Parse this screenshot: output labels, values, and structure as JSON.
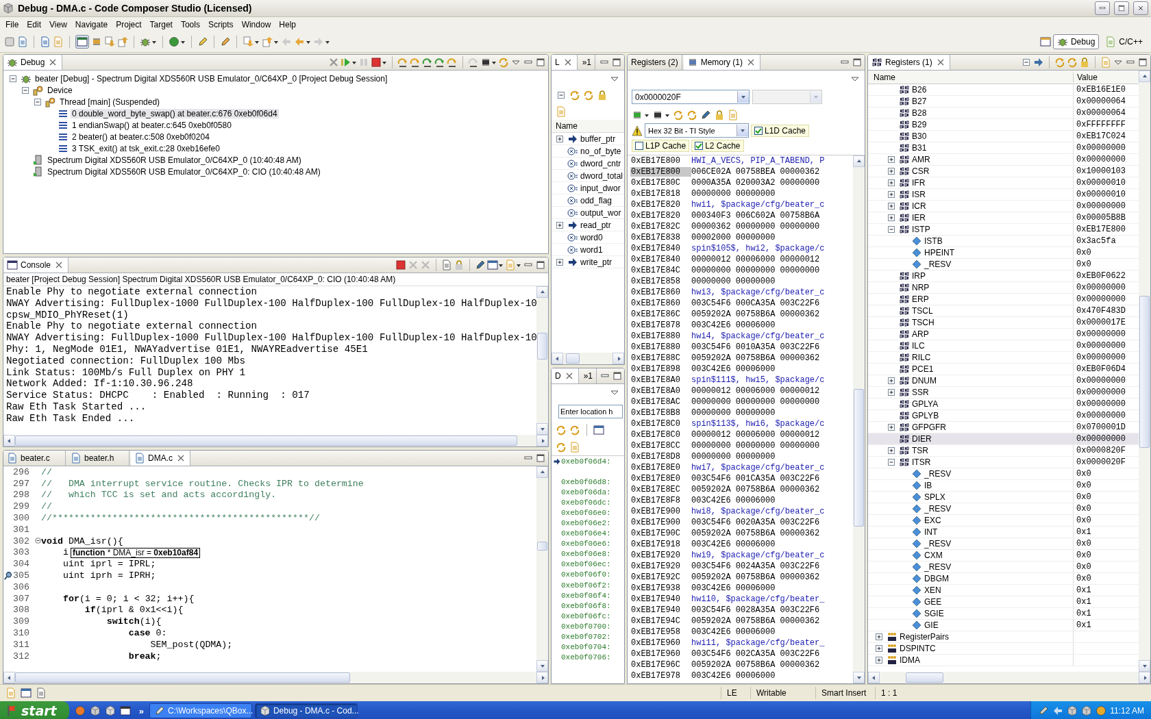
{
  "window": {
    "title": "Debug - DMA.c - Code Composer Studio (Licensed)"
  },
  "menu": [
    "File",
    "Edit",
    "View",
    "Navigate",
    "Project",
    "Target",
    "Tools",
    "Scripts",
    "Window",
    "Help"
  ],
  "perspectives": [
    {
      "label": "Debug",
      "selected": true
    },
    {
      "label": "C/C++",
      "selected": false
    }
  ],
  "debug_view": {
    "tab": "Debug",
    "tree": [
      {
        "label": "beater [Debug] - Spectrum Digital XDS560R USB Emulator_0/C64XP_0 [Project Debug Session]",
        "kind": "session",
        "expanded": true,
        "selected": false,
        "children": [
          {
            "label": "Device",
            "kind": "device",
            "expanded": true,
            "selected": false,
            "children": [
              {
                "label": "Thread [main] (Suspended)",
                "kind": "thread",
                "expanded": true,
                "selected": false,
                "children": [
                  {
                    "label": "0 double_word_byte_swap() at beater.c:676 0xeb0f06d4",
                    "kind": "frame",
                    "selected": true
                  },
                  {
                    "label": "1 endianSwap() at beater.c:645 0xeb0f0580",
                    "kind": "frame",
                    "selected": false
                  },
                  {
                    "label": "2 beater() at beater.c:508 0xeb0f0204",
                    "kind": "frame",
                    "selected": false
                  },
                  {
                    "label": "3 TSK_exit() at tsk_exit.c:28 0xeb16efe0",
                    "kind": "frame",
                    "selected": false
                  }
                ]
              }
            ]
          },
          {
            "label": "Spectrum Digital XDS560R USB Emulator_0/C64XP_0 (10:40:48 AM)",
            "kind": "process",
            "selected": false
          },
          {
            "label": "Spectrum Digital XDS560R USB Emulator_0/C64XP_0: CIO (10:40:48 AM)",
            "kind": "process",
            "selected": false
          }
        ]
      }
    ]
  },
  "console": {
    "tab": "Console",
    "header": "beater [Project Debug Session] Spectrum Digital XDS560R USB Emulator_0/C64XP_0: CIO (10:40:48 AM)",
    "lines": [
      "Enable Phy to negotiate external connection",
      "NWAY Advertising: FullDuplex-1000 FullDuplex-100 HalfDuplex-100 FullDuplex-10 HalfDuplex-10",
      "cpsw_MDIO_PhYReset(1)",
      "Enable Phy to negotiate external connection",
      "NWAY Advertising: FullDuplex-1000 FullDuplex-100 HalfDuplex-100 FullDuplex-10 HalfDuplex-10",
      "Phy: 1, NegMode 01E1, NWAYadvertise 01E1, NWAYREadvertise 45E1",
      "Negotiated connection: FullDuplex 100 Mbs",
      "Link Status: 100Mb/s Full Duplex on PHY 1",
      "Network Added: If-1:10.30.96.248",
      "Service Status: DHCPC    : Enabled  : Running  : 017",
      "Raw Eth Task Started ...",
      "Raw Eth Task Ended ..."
    ]
  },
  "editor": {
    "tabs": [
      {
        "label": "beater.c",
        "selected": false
      },
      {
        "label": "beater.h",
        "selected": false
      },
      {
        "label": "DMA.c",
        "selected": true
      }
    ],
    "hover_tooltip": "**function** * DMA_isr = **0xeb10af84**",
    "lines": [
      {
        "number": "296",
        "kind": "comment",
        "text": "//",
        "fold": false,
        "marker": false,
        "hover": false
      },
      {
        "number": "297",
        "kind": "comment",
        "text": "//   DMA interrupt service routine. Checks IPR to determine",
        "fold": false,
        "marker": false,
        "hover": false
      },
      {
        "number": "298",
        "kind": "comment",
        "text": "//   which TCC is set and acts accordingly.",
        "fold": false,
        "marker": false,
        "hover": false
      },
      {
        "number": "299",
        "kind": "comment",
        "text": "//",
        "fold": false,
        "marker": false,
        "hover": false
      },
      {
        "number": "300",
        "kind": "comment",
        "text": "//***********************************************//",
        "fold": false,
        "marker": false,
        "hover": false
      },
      {
        "number": "301",
        "kind": "code",
        "fold": false,
        "marker": false,
        "hover": false
      },
      {
        "number": "302",
        "kind": "code",
        "text": "**void** DMA_isr(){",
        "fold": true,
        "marker": false,
        "hover": false
      },
      {
        "number": "303",
        "kind": "code",
        "text": "    i",
        "fold": false,
        "marker": false,
        "hover": true
      },
      {
        "number": "304",
        "kind": "code",
        "text": "    uint iprl = IPRL;",
        "fold": false,
        "marker": false,
        "hover": false
      },
      {
        "number": "305",
        "kind": "code",
        "text": "    uint iprh = IPRH;",
        "fold": false,
        "marker": true,
        "hover": false
      },
      {
        "number": "306",
        "kind": "code",
        "fold": false,
        "marker": false,
        "hover": false
      },
      {
        "number": "307",
        "kind": "code",
        "text": "    **for**(i = 0; i < 32; i++){",
        "fold": false,
        "marker": false,
        "hover": false
      },
      {
        "number": "308",
        "kind": "code",
        "text": "        **if**(iprl & 0x1<<i){",
        "fold": false,
        "marker": false,
        "hover": false
      },
      {
        "number": "309",
        "kind": "code",
        "text": "            **switch**(i){",
        "fold": false,
        "marker": false,
        "hover": false
      },
      {
        "number": "310",
        "kind": "code",
        "text": "                **case** 0:",
        "fold": false,
        "marker": false,
        "hover": false
      },
      {
        "number": "311",
        "kind": "code",
        "text": "                    SEM_post(QDMA);",
        "fold": false,
        "marker": false,
        "hover": false
      },
      {
        "number": "312",
        "kind": "code",
        "text": "                **break**;",
        "fold": false,
        "marker": false,
        "hover": false
      }
    ]
  },
  "variables": {
    "tabs": [
      {
        "label": "L",
        "selected": true
      },
      {
        "label": "»1",
        "selected": false
      }
    ],
    "column": "Name",
    "rows": [
      {
        "name": "buffer_ptr",
        "kind": "pointer",
        "expanded": false
      },
      {
        "name": "no_of_byte",
        "kind": "variable"
      },
      {
        "name": "dword_cntr",
        "kind": "variable"
      },
      {
        "name": "dword_total",
        "kind": "variable"
      },
      {
        "name": "input_dwor",
        "kind": "variable"
      },
      {
        "name": "odd_flag",
        "kind": "variable"
      },
      {
        "name": "output_wor",
        "kind": "variable"
      },
      {
        "name": "read_ptr",
        "kind": "pointer",
        "expanded": false
      },
      {
        "name": "word0",
        "kind": "variable"
      },
      {
        "name": "word1",
        "kind": "variable"
      },
      {
        "name": "write_ptr",
        "kind": "pointer",
        "expanded": false
      }
    ]
  },
  "disassembly": {
    "tabs": [
      {
        "label": "D",
        "selected": true
      },
      {
        "label": "»1",
        "selected": false
      }
    ],
    "placeholder": "Enter location h",
    "rows": [
      {
        "address": "0xeb0f06d4:",
        "current": true
      },
      {
        "address": "0xeb0f06d8:",
        "current": false
      },
      {
        "address": "0xeb0f06da:",
        "current": false
      },
      {
        "address": "0xeb0f06dc:",
        "current": false
      },
      {
        "address": "0xeb0f06e0:",
        "current": false
      },
      {
        "address": "0xeb0f06e2:",
        "current": false
      },
      {
        "address": "0xeb0f06e4:",
        "current": false
      },
      {
        "address": "0xeb0f06e6:",
        "current": false
      },
      {
        "address": "0xeb0f06e8:",
        "current": false
      },
      {
        "address": "0xeb0f06ec:",
        "current": false
      },
      {
        "address": "0xeb0f06f0:",
        "current": false
      },
      {
        "address": "0xeb0f06f2:",
        "current": false
      },
      {
        "address": "0xeb0f06f4:",
        "current": false
      },
      {
        "address": "0xeb0f06f8:",
        "current": false
      },
      {
        "address": "0xeb0f06fc:",
        "current": false
      },
      {
        "address": "0xeb0f0700:",
        "current": false
      },
      {
        "address": "0xeb0f0702:",
        "current": false
      },
      {
        "address": "0xeb0f0704:",
        "current": false
      },
      {
        "address": "0xeb0f0706:",
        "current": false
      }
    ]
  },
  "memory": {
    "tabs": [
      {
        "label": "Registers (2)",
        "selected": false
      },
      {
        "label": "Memory (1)",
        "selected": true
      }
    ],
    "address": "0x0000020F",
    "format": "Hex 32 Bit - TI Style",
    "caches": [
      {
        "label": "L1D Cache",
        "checked": true
      },
      {
        "label": "L1P Cache",
        "checked": false
      },
      {
        "label": "L2 Cache",
        "checked": true
      }
    ],
    "rows": [
      {
        "address": "0xEB17E800",
        "kind": "label",
        "content": "HWI_A_VECS, PIP_A_TABEND, P",
        "selected": false
      },
      {
        "address": "0xEB17E800",
        "kind": "data",
        "content": "006CE02A 00758BEA 00000362",
        "selected": true
      },
      {
        "address": "0xEB17E80C",
        "kind": "data",
        "content": "0000A35A 020003A2 00000000",
        "selected": false
      },
      {
        "address": "0xEB17E818",
        "kind": "data",
        "content": "00000000 00000000",
        "selected": false
      },
      {
        "address": "0xEB17E820",
        "kind": "label",
        "content": "hwi1, $package/cfg/beater_c",
        "selected": false
      },
      {
        "address": "0xEB17E820",
        "kind": "data",
        "content": "000340F3 006C602A 00758B6A",
        "selected": false
      },
      {
        "address": "0xEB17E82C",
        "kind": "data",
        "content": "00000362 00000000 00000000",
        "selected": false
      },
      {
        "address": "0xEB17E838",
        "kind": "data",
        "content": "00002000 00000000",
        "selected": false
      },
      {
        "address": "0xEB17E840",
        "kind": "label",
        "content": "spin$105$, hwi2, $package/c",
        "selected": false
      },
      {
        "address": "0xEB17E840",
        "kind": "data",
        "content": "00000012 00006000 00000012",
        "selected": false
      },
      {
        "address": "0xEB17E84C",
        "kind": "data",
        "content": "00000000 00000000 00000000",
        "selected": false
      },
      {
        "address": "0xEB17E858",
        "kind": "data",
        "content": "00000000 00000000",
        "selected": false
      },
      {
        "address": "0xEB17E860",
        "kind": "label",
        "content": "hwi3, $package/cfg/beater_c",
        "selected": false
      },
      {
        "address": "0xEB17E860",
        "kind": "data",
        "content": "003C54F6 000CA35A 003C22F6",
        "selected": false
      },
      {
        "address": "0xEB17E86C",
        "kind": "data",
        "content": "0059202A 00758B6A 00000362",
        "selected": false
      },
      {
        "address": "0xEB17E878",
        "kind": "data",
        "content": "003C42E6 00006000",
        "selected": false
      },
      {
        "address": "0xEB17E880",
        "kind": "label",
        "content": "hwi4, $package/cfg/beater_c",
        "selected": false
      },
      {
        "address": "0xEB17E880",
        "kind": "data",
        "content": "003C54F6 0010A35A 003C22F6",
        "selected": false
      },
      {
        "address": "0xEB17E88C",
        "kind": "data",
        "content": "0059202A 00758B6A 00000362",
        "selected": false
      },
      {
        "address": "0xEB17E898",
        "kind": "data",
        "content": "003C42E6 00006000",
        "selected": false
      },
      {
        "address": "0xEB17E8A0",
        "kind": "label",
        "content": "spin$111$, hwi5, $package/c",
        "selected": false
      },
      {
        "address": "0xEB17E8A0",
        "kind": "data",
        "content": "00000012 00006000 00000012",
        "selected": false
      },
      {
        "address": "0xEB17E8AC",
        "kind": "data",
        "content": "00000000 00000000 00000000",
        "selected": false
      },
      {
        "address": "0xEB17E8B8",
        "kind": "data",
        "content": "00000000 00000000",
        "selected": false
      },
      {
        "address": "0xEB17E8C0",
        "kind": "label",
        "content": "spin$113$, hwi6, $package/c",
        "selected": false
      },
      {
        "address": "0xEB17E8C0",
        "kind": "data",
        "content": "00000012 00006000 00000012",
        "selected": false
      },
      {
        "address": "0xEB17E8CC",
        "kind": "data",
        "content": "00000000 00000000 00000000",
        "selected": false
      },
      {
        "address": "0xEB17E8D8",
        "kind": "data",
        "content": "00000000 00000000",
        "selected": false
      },
      {
        "address": "0xEB17E8E0",
        "kind": "label",
        "content": "hwi7, $package/cfg/beater_c",
        "selected": false
      },
      {
        "address": "0xEB17E8E0",
        "kind": "data",
        "content": "003C54F6 001CA35A 003C22F6",
        "selected": false
      },
      {
        "address": "0xEB17E8EC",
        "kind": "data",
        "content": "0059202A 00758B6A 00000362",
        "selected": false
      },
      {
        "address": "0xEB17E8F8",
        "kind": "data",
        "content": "003C42E6 00006000",
        "selected": false
      },
      {
        "address": "0xEB17E900",
        "kind": "label",
        "content": "hwi8, $package/cfg/beater_c",
        "selected": false
      },
      {
        "address": "0xEB17E900",
        "kind": "data",
        "content": "003C54F6 0020A35A 003C22F6",
        "selected": false
      },
      {
        "address": "0xEB17E90C",
        "kind": "data",
        "content": "0059202A 00758B6A 00000362",
        "selected": false
      },
      {
        "address": "0xEB17E918",
        "kind": "data",
        "content": "003C42E6 00006000",
        "selected": false
      },
      {
        "address": "0xEB17E920",
        "kind": "label",
        "content": "hwi9, $package/cfg/beater_c",
        "selected": false
      },
      {
        "address": "0xEB17E920",
        "kind": "data",
        "content": "003C54F6 0024A35A 003C22F6",
        "selected": false
      },
      {
        "address": "0xEB17E92C",
        "kind": "data",
        "content": "0059202A 00758B6A 00000362",
        "selected": false
      },
      {
        "address": "0xEB17E938",
        "kind": "data",
        "content": "003C42E6 00006000",
        "selected": false
      },
      {
        "address": "0xEB17E940",
        "kind": "label",
        "content": "hwi10, $package/cfg/beater_",
        "selected": false
      },
      {
        "address": "0xEB17E940",
        "kind": "data",
        "content": "003C54F6 0028A35A 003C22F6",
        "selected": false
      },
      {
        "address": "0xEB17E94C",
        "kind": "data",
        "content": "0059202A 00758B6A 00000362",
        "selected": false
      },
      {
        "address": "0xEB17E958",
        "kind": "data",
        "content": "003C42E6 00006000",
        "selected": false
      },
      {
        "address": "0xEB17E960",
        "kind": "label",
        "content": "hwi11, $package/cfg/beater_",
        "selected": false
      },
      {
        "address": "0xEB17E960",
        "kind": "data",
        "content": "003C54F6 002CA35A 003C22F6",
        "selected": false
      },
      {
        "address": "0xEB17E96C",
        "kind": "data",
        "content": "0059202A 00758B6A 00000362",
        "selected": false
      },
      {
        "address": "0xEB17E978",
        "kind": "data",
        "content": "003C42E6 00006000",
        "selected": false
      }
    ]
  },
  "registers": {
    "tab": "Registers (1)",
    "columns": [
      "Name",
      "Value"
    ],
    "rows": [
      {
        "name": "B26",
        "value": "0xEB16E1E0",
        "selected": false
      },
      {
        "name": "B27",
        "value": "0x00000064",
        "selected": false
      },
      {
        "name": "B28",
        "value": "0x00000064",
        "selected": false
      },
      {
        "name": "B29",
        "value": "0xFFFFFFFF",
        "selected": false
      },
      {
        "name": "B30",
        "value": "0xEB17C024",
        "selected": false
      },
      {
        "name": "B31",
        "value": "0x00000000",
        "selected": false
      },
      {
        "name": "AMR",
        "value": "0x00000000",
        "selected": false,
        "expanded": false
      },
      {
        "name": "CSR",
        "value": "0x10000103",
        "selected": false,
        "expanded": false
      },
      {
        "name": "IFR",
        "value": "0x00000010",
        "selected": false,
        "expanded": false
      },
      {
        "name": "ISR",
        "value": "0x00000010",
        "selected": false,
        "expanded": false
      },
      {
        "name": "ICR",
        "value": "0x00000000",
        "selected": false,
        "expanded": false
      },
      {
        "name": "IER",
        "value": "0x00005B8B",
        "selected": false,
        "expanded": false
      },
      {
        "name": "ISTP",
        "value": "0xEB17E800",
        "selected": false,
        "expanded": true,
        "children": [
          {
            "name": "ISTB",
            "value": "0x3ac5fa",
            "selected": false
          },
          {
            "name": "HPEINT",
            "value": "0x0",
            "selected": false
          },
          {
            "name": "_RESV",
            "value": "0x0",
            "selected": false
          }
        ]
      },
      {
        "name": "IRP",
        "value": "0xEB0F0622",
        "selected": false
      },
      {
        "name": "NRP",
        "value": "0x00000000",
        "selected": false
      },
      {
        "name": "ERP",
        "value": "0x00000000",
        "selected": false
      },
      {
        "name": "TSCL",
        "value": "0x470F483D",
        "selected": false
      },
      {
        "name": "TSCH",
        "value": "0x0000017E",
        "selected": false
      },
      {
        "name": "ARP",
        "value": "0x00000000",
        "selected": false
      },
      {
        "name": "ILC",
        "value": "0x00000000",
        "selected": false
      },
      {
        "name": "RILC",
        "value": "0x00000000",
        "selected": false
      },
      {
        "name": "PCE1",
        "value": "0xEB0F06D4",
        "selected": false
      },
      {
        "name": "DNUM",
        "value": "0x00000000",
        "selected": false,
        "expanded": false
      },
      {
        "name": "SSR",
        "value": "0x00000000",
        "selected": false,
        "expanded": false
      },
      {
        "name": "GPLYA",
        "value": "0x00000000",
        "selected": false
      },
      {
        "name": "GPLYB",
        "value": "0x00000000",
        "selected": false
      },
      {
        "name": "GFPGFR",
        "value": "0x0700001D",
        "selected": false,
        "expanded": false
      },
      {
        "name": "DIER",
        "value": "0x00000000",
        "selected": true
      },
      {
        "name": "TSR",
        "value": "0x0000820F",
        "selected": false,
        "expanded": false
      },
      {
        "name": "ITSR",
        "value": "0x0000020F",
        "selected": false,
        "expanded": true,
        "children": [
          {
            "name": "_RESV",
            "value": "0x0",
            "selected": false
          },
          {
            "name": "IB",
            "value": "0x0",
            "selected": false
          },
          {
            "name": "SPLX",
            "value": "0x0",
            "selected": false
          },
          {
            "name": "_RESV",
            "value": "0x0",
            "selected": false
          },
          {
            "name": "EXC",
            "value": "0x0",
            "selected": false
          },
          {
            "name": "INT",
            "value": "0x1",
            "selected": false
          },
          {
            "name": "_RESV",
            "value": "0x0",
            "selected": false
          },
          {
            "name": "CXM",
            "value": "0x0",
            "selected": false
          },
          {
            "name": "_RESV",
            "value": "0x0",
            "selected": false
          },
          {
            "name": "DBGM",
            "value": "0x0",
            "selected": false
          },
          {
            "name": "XEN",
            "value": "0x1",
            "selected": false
          },
          {
            "name": "GEE",
            "value": "0x1",
            "selected": false
          },
          {
            "name": "SGIE",
            "value": "0x1",
            "selected": false
          },
          {
            "name": "GIE",
            "value": "0x1",
            "selected": false
          }
        ]
      }
    ],
    "groups": [
      {
        "name": "RegisterPairs",
        "expanded": false,
        "selected": false
      },
      {
        "name": "DSPINTC",
        "expanded": false,
        "selected": false
      },
      {
        "name": "IDMA",
        "expanded": false,
        "selected": false
      }
    ]
  },
  "status_bar": [
    "LE",
    "Writable",
    "Smart Insert",
    "1 : 1"
  ],
  "taskbar": {
    "start": "start",
    "more": "»",
    "tasks": [
      {
        "label": "C:\\Workspaces\\QBox...",
        "selected": false
      },
      {
        "label": "Debug - DMA.c - Cod...",
        "selected": true
      }
    ],
    "clock": "11:12 AM"
  }
}
